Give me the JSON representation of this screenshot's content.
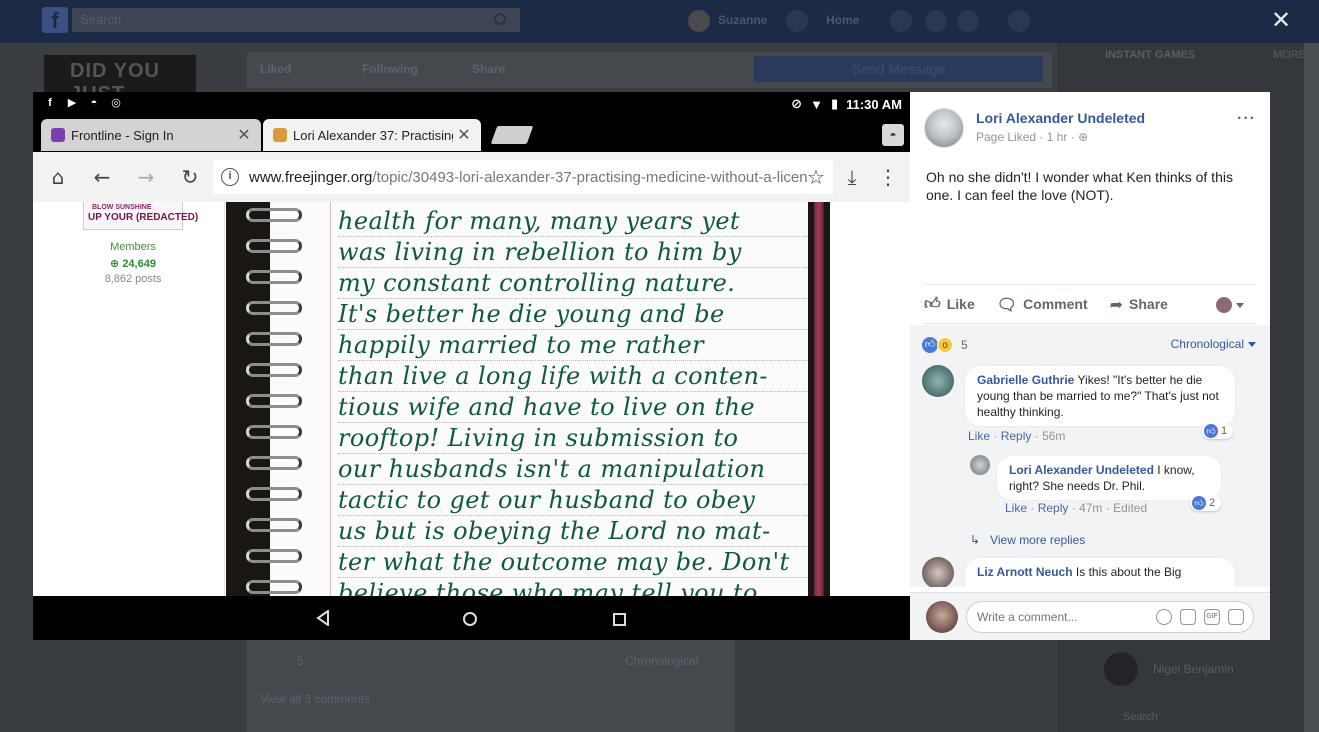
{
  "background": {
    "search_placeholder": "Search",
    "user_name": "Suzanne",
    "home_label": "Home",
    "page_banner": "DID YOU JUST...",
    "liked_label": "Liked",
    "following_label": "Following",
    "share_label": "Share",
    "send_message_label": "Send Message",
    "instant_games_label": "INSTANT GAMES",
    "more_label": "MORE",
    "post_reaction_count": "5",
    "post_chronological": "Chronological",
    "view_all_comments": "View all 3 comments",
    "sidebar_contact": "Nigel Benjamin",
    "sidebar_search_placeholder": "Search"
  },
  "viewer": {
    "close_glyph": "✕"
  },
  "phone": {
    "time": "11:30 AM",
    "tabs": [
      {
        "title": "Frontline - Sign In"
      },
      {
        "title": "Lori Alexander 37: Practising M"
      }
    ],
    "url_host": "www.freejinger.org",
    "url_path": "/topic/30493-lori-alexander-37-practising-medicine-without-a-licen",
    "forum": {
      "rank_line1": "BLOW SUNSHINE",
      "rank_line2": "UP YOUR (REDACTED)",
      "group": "Members",
      "reputation": "24,649",
      "posts": "8,862 posts"
    },
    "handwriting": [
      "health for many, many years yet",
      "was living in rebellion to him by",
      "my constant controlling nature.",
      "It's better he die young and be",
      "happily married to me rather",
      "than live a long life with a conten-",
      "tious wife and have to live on the",
      "rooftop! Living in submission to",
      "our husbands isn't a manipulation",
      "tactic to get our husband to obey",
      "us but is obeying the Lord no mat-",
      "ter what the outcome may be. Don't",
      "believe those who may tell you to"
    ]
  },
  "post": {
    "page_name": "Lori Alexander Undeleted",
    "page_status": "Page Liked",
    "time": "1 hr",
    "text": "Oh no she didn't! I wonder what Ken thinks of this one. I can feel the love (NOT).",
    "actions": {
      "like": "Like",
      "comment": "Comment",
      "share": "Share"
    },
    "reaction_count": "5",
    "sort_label": "Chronological"
  },
  "comments": [
    {
      "author": "Gabrielle Guthrie",
      "text": "Yikes! \"It's better he die young than be married to me?\" That's just not healthy thinking.",
      "like": "Like",
      "reply": "Reply",
      "time": "56m",
      "reactions": "1"
    },
    {
      "author": "Lori Alexander Undeleted",
      "text": "I know, right? She needs Dr. Phil.",
      "like": "Like",
      "reply": "Reply",
      "time": "47m",
      "edited": "Edited",
      "reactions": "2"
    },
    {
      "author": "Liz Arnott Neuch",
      "text": "Is this about the Big"
    }
  ],
  "view_more_replies": "View more replies",
  "write_comment_placeholder": "Write a comment...",
  "colors": {
    "fb_blue": "#365899",
    "link_blue": "#4b67a1",
    "ink_green": "#0f5a3a"
  }
}
